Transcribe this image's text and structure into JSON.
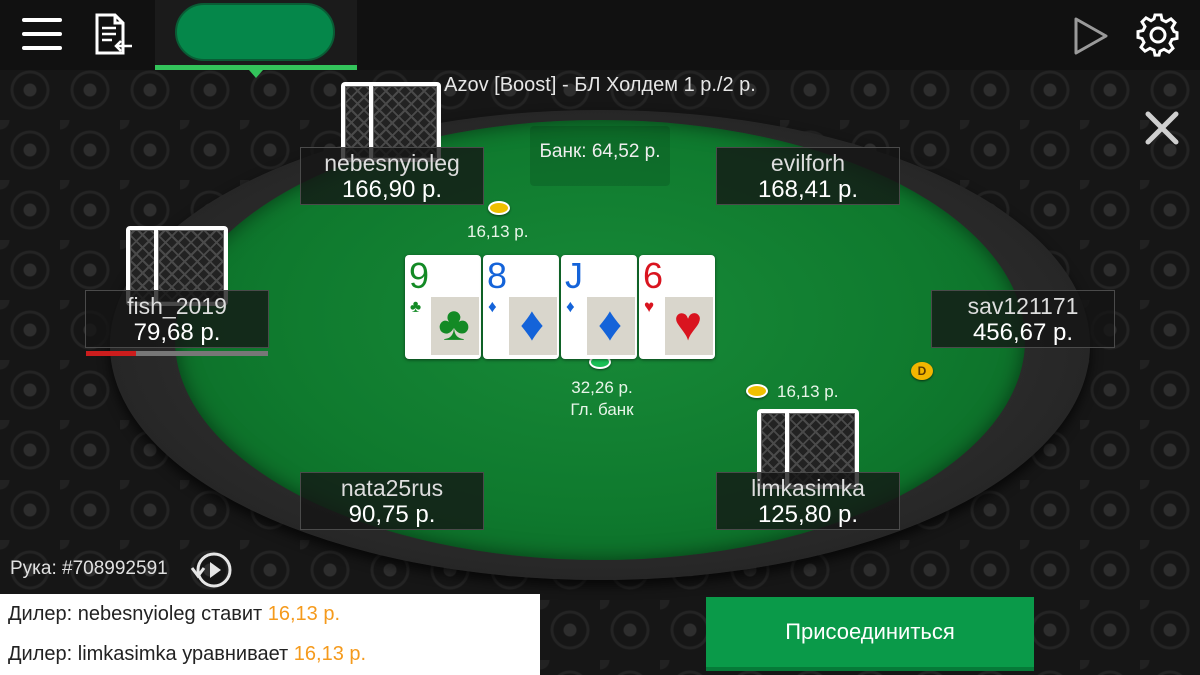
{
  "header": {
    "table_title": "Azov [Boost] - БЛ Холдем 1 р./2 р."
  },
  "pot": {
    "label": "Банк: 64,52 р."
  },
  "main_pot": {
    "amount": "32,26 р.",
    "label": "Гл. банк"
  },
  "players": {
    "nebesnyioleg": {
      "name": "nebesnyioleg",
      "stack": "166,90 р.",
      "bet": "16,13 р."
    },
    "evilforh": {
      "name": "evilforh",
      "stack": "168,41 р."
    },
    "fish_2019": {
      "name": "fish_2019",
      "stack": "79,68 р."
    },
    "sav121171": {
      "name": "sav121171",
      "stack": "456,67 р."
    },
    "nata25rus": {
      "name": "nata25rus",
      "stack": "90,75 р."
    },
    "limkasimka": {
      "name": "limkasimka",
      "stack": "125,80 р.",
      "bet": "16,13 р."
    }
  },
  "board": [
    {
      "rank": "9",
      "suit": "♣",
      "color": "#138a25"
    },
    {
      "rank": "8",
      "suit": "♦",
      "color": "#1463d9"
    },
    {
      "rank": "J",
      "suit": "♦",
      "color": "#1463d9"
    },
    {
      "rank": "6",
      "suit": "♥",
      "color": "#d9141f"
    }
  ],
  "dealer_button": "D",
  "hand": {
    "label": "Рука: #708992591"
  },
  "log": [
    {
      "text": "Дилер: nebesnyioleg ставит ",
      "amount": "16,13 р."
    },
    {
      "text": "Дилер: limkasimka уравнивает ",
      "amount": "16,13 р."
    }
  ],
  "join_button": "Присоединиться",
  "colors": {
    "accent_green": "#0a9a49",
    "chip_yellow": "#f0c000",
    "log_amount": "#f59a1c",
    "timer_red": "#cc1d1d"
  }
}
